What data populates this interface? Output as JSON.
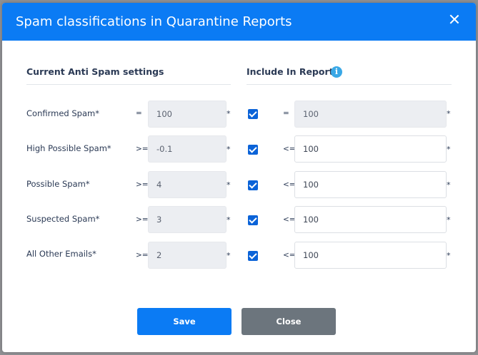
{
  "modal": {
    "title": "Spam classifications in Quarantine Reports"
  },
  "sections": {
    "current": "Current Anti Spam settings",
    "include": "Include In Report"
  },
  "rows": [
    {
      "label": "Confirmed Spam*",
      "left_op": "=",
      "current": "100",
      "included": true,
      "right_op": "=",
      "report": "100",
      "required": "*"
    },
    {
      "label": "High Possible Spam*",
      "left_op": ">=",
      "current": "-0.1",
      "included": true,
      "right_op": "<=",
      "report": "100",
      "required": "*"
    },
    {
      "label": "Possible Spam*",
      "left_op": ">=",
      "current": "4",
      "included": true,
      "right_op": "<=",
      "report": "100",
      "required": "*"
    },
    {
      "label": "Suspected Spam*",
      "left_op": ">=",
      "current": "3",
      "included": true,
      "right_op": "<=",
      "report": "100",
      "required": "*"
    },
    {
      "label": "All Other Emails*",
      "left_op": ">=",
      "current": "2",
      "included": true,
      "right_op": "<=",
      "report": "100",
      "required": "*"
    }
  ],
  "buttons": {
    "save": "Save",
    "close": "Close"
  },
  "icons": {
    "info": "i"
  },
  "colors": {
    "header": "#0b7bf4",
    "save": "#0b7bf4",
    "close": "#6c757d",
    "checkbox": "#0b63d8"
  }
}
